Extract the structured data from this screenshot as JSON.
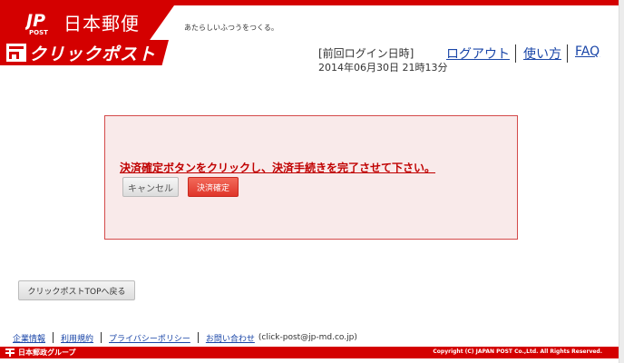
{
  "header": {
    "logo_text": "日本郵便",
    "tagline": "あたらしいふつうをつくる。",
    "service_name": "クリックポスト",
    "last_login_label": "[前回ログイン日時]",
    "last_login_time": "2014年06月30日 21時13分",
    "nav": {
      "logout": "ログアウト",
      "howto": "使い方",
      "faq": "FAQ"
    }
  },
  "alert": {
    "message": "決済確定ボタンをクリックし、決済手続きを完了させて下さい。",
    "cancel_label": "キャンセル",
    "confirm_label": "決済確定"
  },
  "back_button_label": "クリックポストTOPへ戻る",
  "footer": {
    "links": [
      "企業情報",
      "利用規約",
      "プライバシーポリシー",
      "お問い合わせ"
    ],
    "email": "(click-post@jp-md.co.jp)",
    "group_name": "日本郵政グループ",
    "copyright": "Copyright (C) JAPAN POST Co.,Ltd.  All Rights Reserved."
  },
  "colors": {
    "brand_red": "#d40000",
    "link_blue": "#1a46a8",
    "alert_bg": "#f9eaea"
  }
}
